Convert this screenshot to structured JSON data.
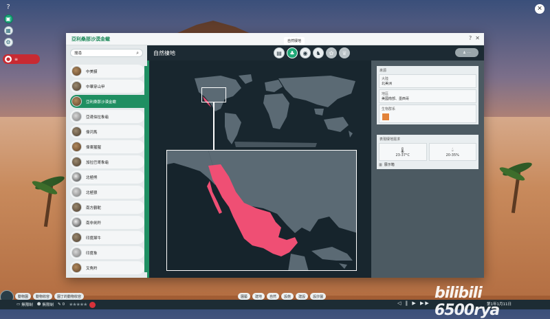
{
  "window": {
    "title": "亞利桑那沙漠金蠍",
    "help": "?",
    "close": "✕"
  },
  "sidebar": {
    "search_placeholder": "搜尋",
    "animals": [
      {
        "name": "中美貘"
      },
      {
        "name": "中華穿山甲"
      },
      {
        "name": "亞利桑那沙漠金蠍",
        "selected": true
      },
      {
        "name": "亞達伯拉象龜"
      },
      {
        "name": "偉河馬"
      },
      {
        "name": "偉東猩猩"
      },
      {
        "name": "加拉巴哥象龜"
      },
      {
        "name": "北極熊"
      },
      {
        "name": "北極狼"
      },
      {
        "name": "南方鶴駝"
      },
      {
        "name": "南非劍羚"
      },
      {
        "name": "印度犀牛"
      },
      {
        "name": "印度象"
      },
      {
        "name": "叉角羚"
      }
    ]
  },
  "content": {
    "header": "自然棲地",
    "tab_tooltip": "自然棲地",
    "tabs": [
      {
        "icon": "clipboard-icon",
        "glyph": "▤"
      },
      {
        "icon": "habitat-icon",
        "glyph": "♣",
        "active": true
      },
      {
        "icon": "food-icon",
        "glyph": "◉"
      },
      {
        "icon": "enrichment-icon",
        "glyph": "♞"
      },
      {
        "icon": "paw-icon",
        "glyph": "✿",
        "disabled": true
      },
      {
        "icon": "trophy-icon",
        "glyph": "♛",
        "disabled": true
      }
    ]
  },
  "info": {
    "continent_label": "大陸",
    "continent_value": "北美洲",
    "region_label": "地區",
    "region_value": "美國南部、墨西哥",
    "biome_label": "生物群系",
    "biome_color": "#e2833a",
    "needs_header": "表現棲地需求",
    "temperature": "23-37°C",
    "humidity": "20-35%",
    "exhibit_label": "展示箱"
  },
  "bottom": {
    "tabs": [
      "動物園",
      "動物收容",
      "園丁的動物收容"
    ],
    "money": "無限制",
    "guests": "無限制",
    "tickets": "0",
    "tools": [
      "園藝",
      "建地",
      "自然",
      "設施",
      "建設",
      "設計圖"
    ],
    "date": "第1年1月11日"
  },
  "watermark": "bilibili 6500rya",
  "colors": {
    "accent_green": "#1f8f62",
    "habitat_range": "#ef4f74",
    "map_bg": "#18262e",
    "land": "#5b6a74"
  }
}
